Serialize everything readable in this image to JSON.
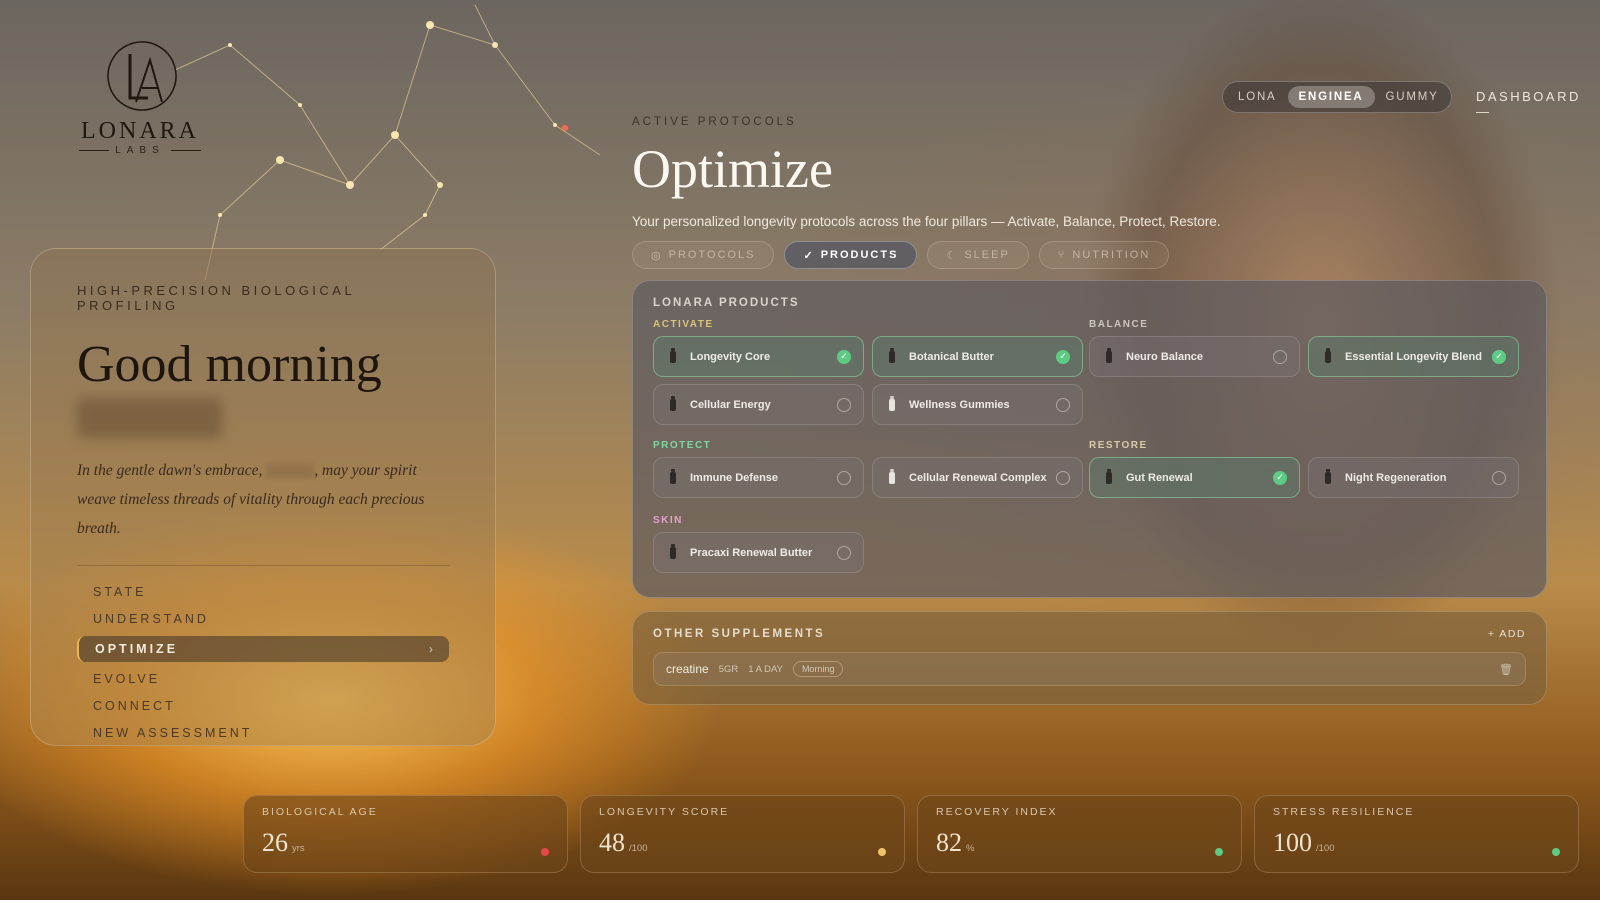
{
  "brand": {
    "name": "LONARA",
    "sub": "LABS"
  },
  "left": {
    "eyebrow": "HIGH-PRECISION BIOLOGICAL PROFILING",
    "greeting": "Good morning",
    "quote_before": "In the gentle dawn's embrace,",
    "quote_after": ", may your spirit weave timeless threads of vitality through each precious breath.",
    "nav": [
      {
        "label": "STATE"
      },
      {
        "label": "UNDERSTAND"
      },
      {
        "label": "OPTIMIZE",
        "active": true
      },
      {
        "label": "EVOLVE"
      },
      {
        "label": "CONNECT"
      },
      {
        "label": "NEW ASSESSMENT"
      }
    ],
    "active_chevron": "›"
  },
  "modes": [
    {
      "label": "LONA",
      "active": false
    },
    {
      "label": "ENGINEA",
      "active": true
    },
    {
      "label": "GUMMY",
      "active": false
    }
  ],
  "dashboard_link": "DASHBOARD —",
  "header": {
    "eyebrow": "ACTIVE PROTOCOLS",
    "title": "Optimize",
    "subtitle": "Your personalized longevity protocols across the four pillars — Activate, Balance, Protect, Restore."
  },
  "tabs": [
    {
      "label": "PROTOCOLS",
      "icon": "dot-icon",
      "glyph": "◎",
      "active": false
    },
    {
      "label": "PRODUCTS",
      "icon": "check-icon",
      "glyph": "✓",
      "active": true
    },
    {
      "label": "SLEEP",
      "icon": "moon-icon",
      "glyph": "☾",
      "active": false
    },
    {
      "label": "NUTRITION",
      "icon": "fork-knife-icon",
      "glyph": "⑂",
      "active": false
    }
  ],
  "products": {
    "title": "LONARA PRODUCTS",
    "groups": [
      {
        "label": "ACTIVATE",
        "color": "#d9c27a",
        "items": [
          {
            "name": "Longevity Core",
            "selected": true,
            "bottle": "dark"
          },
          {
            "name": "Botanical Butter",
            "selected": true,
            "bottle": "dark"
          },
          {
            "name": "Cellular Energy",
            "selected": false,
            "bottle": "dark"
          },
          {
            "name": "Wellness Gummies",
            "selected": false,
            "bottle": "white"
          }
        ]
      },
      {
        "label": "BALANCE",
        "color": "#c9c4bd",
        "items": [
          {
            "name": "Neuro Balance",
            "selected": false,
            "bottle": "dark"
          },
          {
            "name": "Essential Longevity Blend",
            "selected": true,
            "bottle": "dark"
          }
        ]
      },
      {
        "label": "PROTECT",
        "color": "#7fd6a0",
        "items": [
          {
            "name": "Immune Defense",
            "selected": false,
            "bottle": "dark"
          },
          {
            "name": "Cellular Renewal Complex",
            "selected": false,
            "bottle": "white"
          }
        ]
      },
      {
        "label": "RESTORE",
        "color": "#d9c9a8",
        "items": [
          {
            "name": "Gut Renewal",
            "selected": true,
            "bottle": "dark"
          },
          {
            "name": "Night Regeneration",
            "selected": false,
            "bottle": "dark"
          }
        ]
      },
      {
        "label": "SKIN",
        "color": "#e59fd0",
        "items": [
          {
            "name": "Pracaxi Renewal Butter",
            "selected": false,
            "bottle": "dark"
          }
        ]
      }
    ]
  },
  "other_supplements": {
    "title": "OTHER SUPPLEMENTS",
    "add_label": "+ ADD",
    "items": [
      {
        "name": "creatine",
        "dose": "5GR",
        "frequency": "1 A DAY",
        "time": "Morning"
      }
    ]
  },
  "metrics": [
    {
      "label": "BIOLOGICAL AGE",
      "value": "26",
      "unit": "yrs",
      "status_color": "#e54848"
    },
    {
      "label": "LONGEVITY SCORE",
      "value": "48",
      "unit": "/100",
      "status_color": "#f0c46a"
    },
    {
      "label": "RECOVERY INDEX",
      "value": "82",
      "unit": "%",
      "status_color": "#5ecb84"
    },
    {
      "label": "STRESS RESILIENCE",
      "value": "100",
      "unit": "/100",
      "status_color": "#5ecb84"
    }
  ]
}
